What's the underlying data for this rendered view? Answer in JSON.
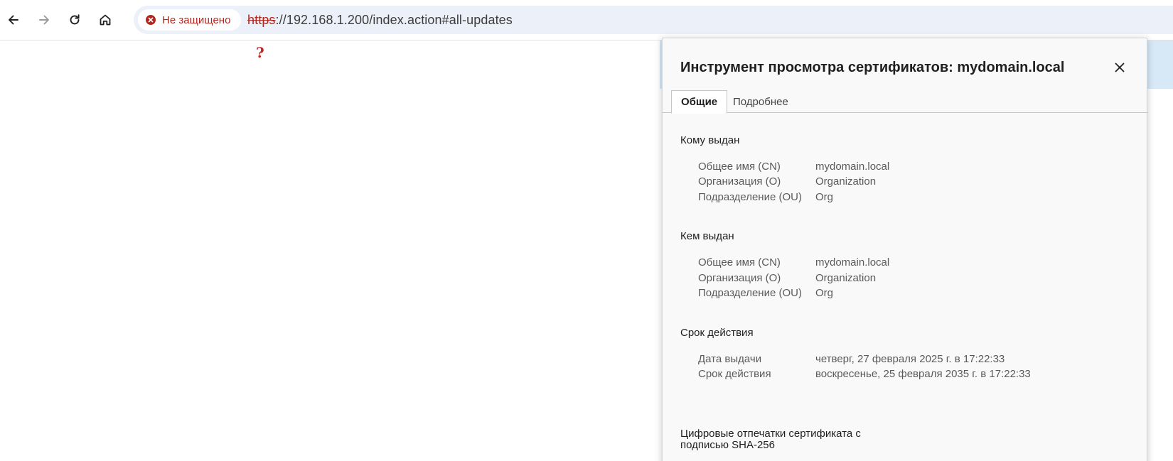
{
  "colors": {
    "insecure_red": "#b3261e",
    "omnibox_bg": "#ecf0f8",
    "dialog_bg": "#f9f9f9",
    "page_strip": "#d7e9f7"
  },
  "toolbar": {
    "back_icon": "arrow-left-icon",
    "forward_icon": "arrow-right-icon",
    "reload_icon": "reload-icon",
    "home_icon": "home-icon",
    "security_label": "Не защищено",
    "url_scheme": "https",
    "url_rest": "://192.168.1.200/index.action#all-updates"
  },
  "page": {
    "placeholder_glyph": "?"
  },
  "dialog": {
    "title": "Инструмент просмотра сертификатов: mydomain.local",
    "tabs": [
      "Общие",
      "Подробнее"
    ],
    "issued_to": {
      "heading": "Кому выдан",
      "rows": [
        {
          "key": "Общее имя (CN)",
          "value": "mydomain.local"
        },
        {
          "key": "Организация (O)",
          "value": "Organization"
        },
        {
          "key": "Подразделение (OU)",
          "value": "Org"
        }
      ]
    },
    "issued_by": {
      "heading": "Кем выдан",
      "rows": [
        {
          "key": "Общее имя (CN)",
          "value": "mydomain.local"
        },
        {
          "key": "Организация (O)",
          "value": "Organization"
        },
        {
          "key": "Подразделение (OU)",
          "value": "Org"
        }
      ]
    },
    "validity": {
      "heading": "Срок действия",
      "rows": [
        {
          "key": "Дата выдачи",
          "value": "четверг, 27 февраля 2025 г. в 17:22:33"
        },
        {
          "key": "Срок действия",
          "value": "воскресенье, 25 февраля 2035 г. в 17:22:33"
        }
      ]
    },
    "fingerprints": {
      "heading_line1": "Цифровые отпечатки сертификата с",
      "heading_line2": "подписью SHA-256"
    }
  }
}
